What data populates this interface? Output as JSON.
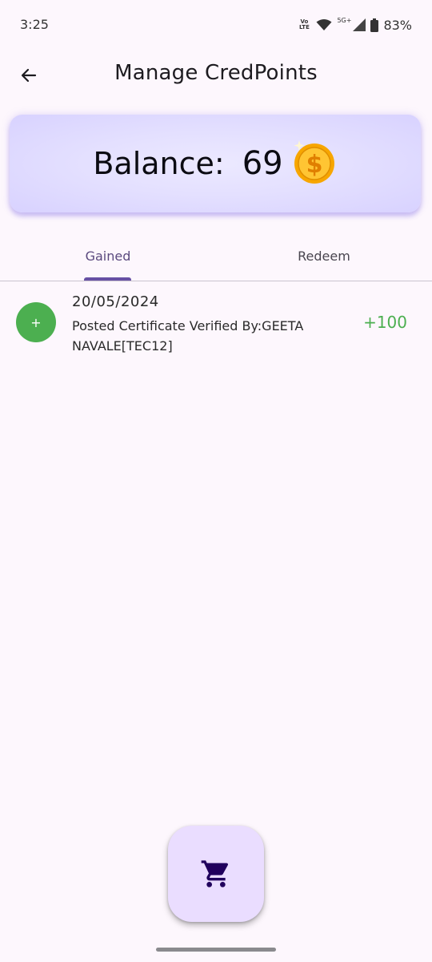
{
  "status_bar": {
    "time": "3:25",
    "volte_line1": "Vo",
    "volte_line2": "LTE",
    "network": "5G+",
    "battery": "83%"
  },
  "app_bar": {
    "title": "Manage CredPoints",
    "back_icon": "arrow-left-icon"
  },
  "balance": {
    "label": "Balance:",
    "value": "69",
    "icon": "coin-icon"
  },
  "tabs": [
    {
      "label": "Gained",
      "selected": true
    },
    {
      "label": "Redeem",
      "selected": false
    }
  ],
  "transactions": [
    {
      "icon_text": "+",
      "date": "20/05/2024",
      "description": "Posted Certificate Verified By:GEETA NAVALE[TEC12]",
      "amount": "+100",
      "amount_color": "#4caf50"
    }
  ],
  "fab": {
    "icon": "shopping-cart-icon"
  },
  "colors": {
    "background": "#fdf7fd",
    "accent": "#6750a4",
    "positive": "#4caf50",
    "fab": "#eaddff"
  }
}
